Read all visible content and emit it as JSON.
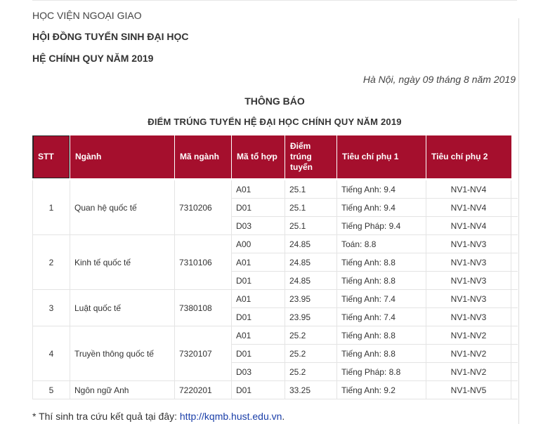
{
  "header": {
    "organization": "HỌC VIỆN NGOẠI GIAO",
    "council": "HỘI ĐỒNG TUYỂN SINH ĐẠI HỌC",
    "system": "HỆ CHÍNH QUY NĂM 2019",
    "date": "Hà Nội, ngày 09 tháng 8 năm 2019",
    "announcement": "THÔNG BÁO",
    "title": "ĐIỂM TRÚNG TUYỂN HỆ ĐẠI HỌC CHÍNH QUY NĂM 2019"
  },
  "table": {
    "columns": [
      "STT",
      "Ngành",
      "Mã ngành",
      "Mã tổ hợp",
      "Điểm trúng tuyển",
      "Tiêu chí phụ 1",
      "Tiêu chí phụ 2"
    ],
    "rows": [
      {
        "stt": "1",
        "major": "Quan hệ quốc tế",
        "code": "7310206",
        "combo": "A01",
        "score": "25.1",
        "crit1": "Tiếng Anh: 9.4",
        "crit2": "NV1-NV4"
      },
      {
        "stt": "",
        "major": "",
        "code": "",
        "combo": "D01",
        "score": "25.1",
        "crit1": "Tiếng Anh: 9.4",
        "crit2": "NV1-NV4"
      },
      {
        "stt": "",
        "major": "",
        "code": "",
        "combo": "D03",
        "score": "25.1",
        "crit1": "Tiếng Pháp: 9.4",
        "crit2": "NV1-NV4"
      },
      {
        "stt": "2",
        "major": "Kinh tế quốc tế",
        "code": "7310106",
        "combo": "A00",
        "score": "24.85",
        "crit1": "Toán: 8.8",
        "crit2": "NV1-NV3"
      },
      {
        "stt": "",
        "major": "",
        "code": "",
        "combo": "A01",
        "score": "24.85",
        "crit1": "Tiếng Anh: 8.8",
        "crit2": "NV1-NV3"
      },
      {
        "stt": "",
        "major": "",
        "code": "",
        "combo": "D01",
        "score": "24.85",
        "crit1": "Tiếng Anh: 8.8",
        "crit2": "NV1-NV3"
      },
      {
        "stt": "3",
        "major": "Luật quốc tế",
        "code": "7380108",
        "combo": "A01",
        "score": "23.95",
        "crit1": "Tiếng Anh: 7.4",
        "crit2": "NV1-NV3"
      },
      {
        "stt": "",
        "major": "",
        "code": "",
        "combo": "D01",
        "score": "23.95",
        "crit1": "Tiếng Anh: 7.4",
        "crit2": "NV1-NV3"
      },
      {
        "stt": "4",
        "major": "Truyền thông quốc tế",
        "code": "7320107",
        "combo": "A01",
        "score": "25.2",
        "crit1": "Tiếng Anh: 8.8",
        "crit2": "NV1-NV2"
      },
      {
        "stt": "",
        "major": "",
        "code": "",
        "combo": "D01",
        "score": "25.2",
        "crit1": "Tiếng Anh: 8.8",
        "crit2": "NV1-NV2"
      },
      {
        "stt": "",
        "major": "",
        "code": "",
        "combo": "D03",
        "score": "25.2",
        "crit1": "Tiếng Pháp: 8.8",
        "crit2": "NV1-NV2"
      },
      {
        "stt": "5",
        "major": "Ngôn ngữ Anh",
        "code": "7220201",
        "combo": "D01",
        "score": "33.25",
        "crit1": "Tiếng Anh: 9.2",
        "crit2": "NV1-NV5"
      }
    ]
  },
  "footer": {
    "note": "* Thí sinh tra cứu kết quả tại đây: ",
    "link_text": "http://kqmb.hust.edu.vn",
    "trailing": "."
  },
  "colors": {
    "header_bg": "#a50f2d",
    "link": "#1a3ea8"
  }
}
